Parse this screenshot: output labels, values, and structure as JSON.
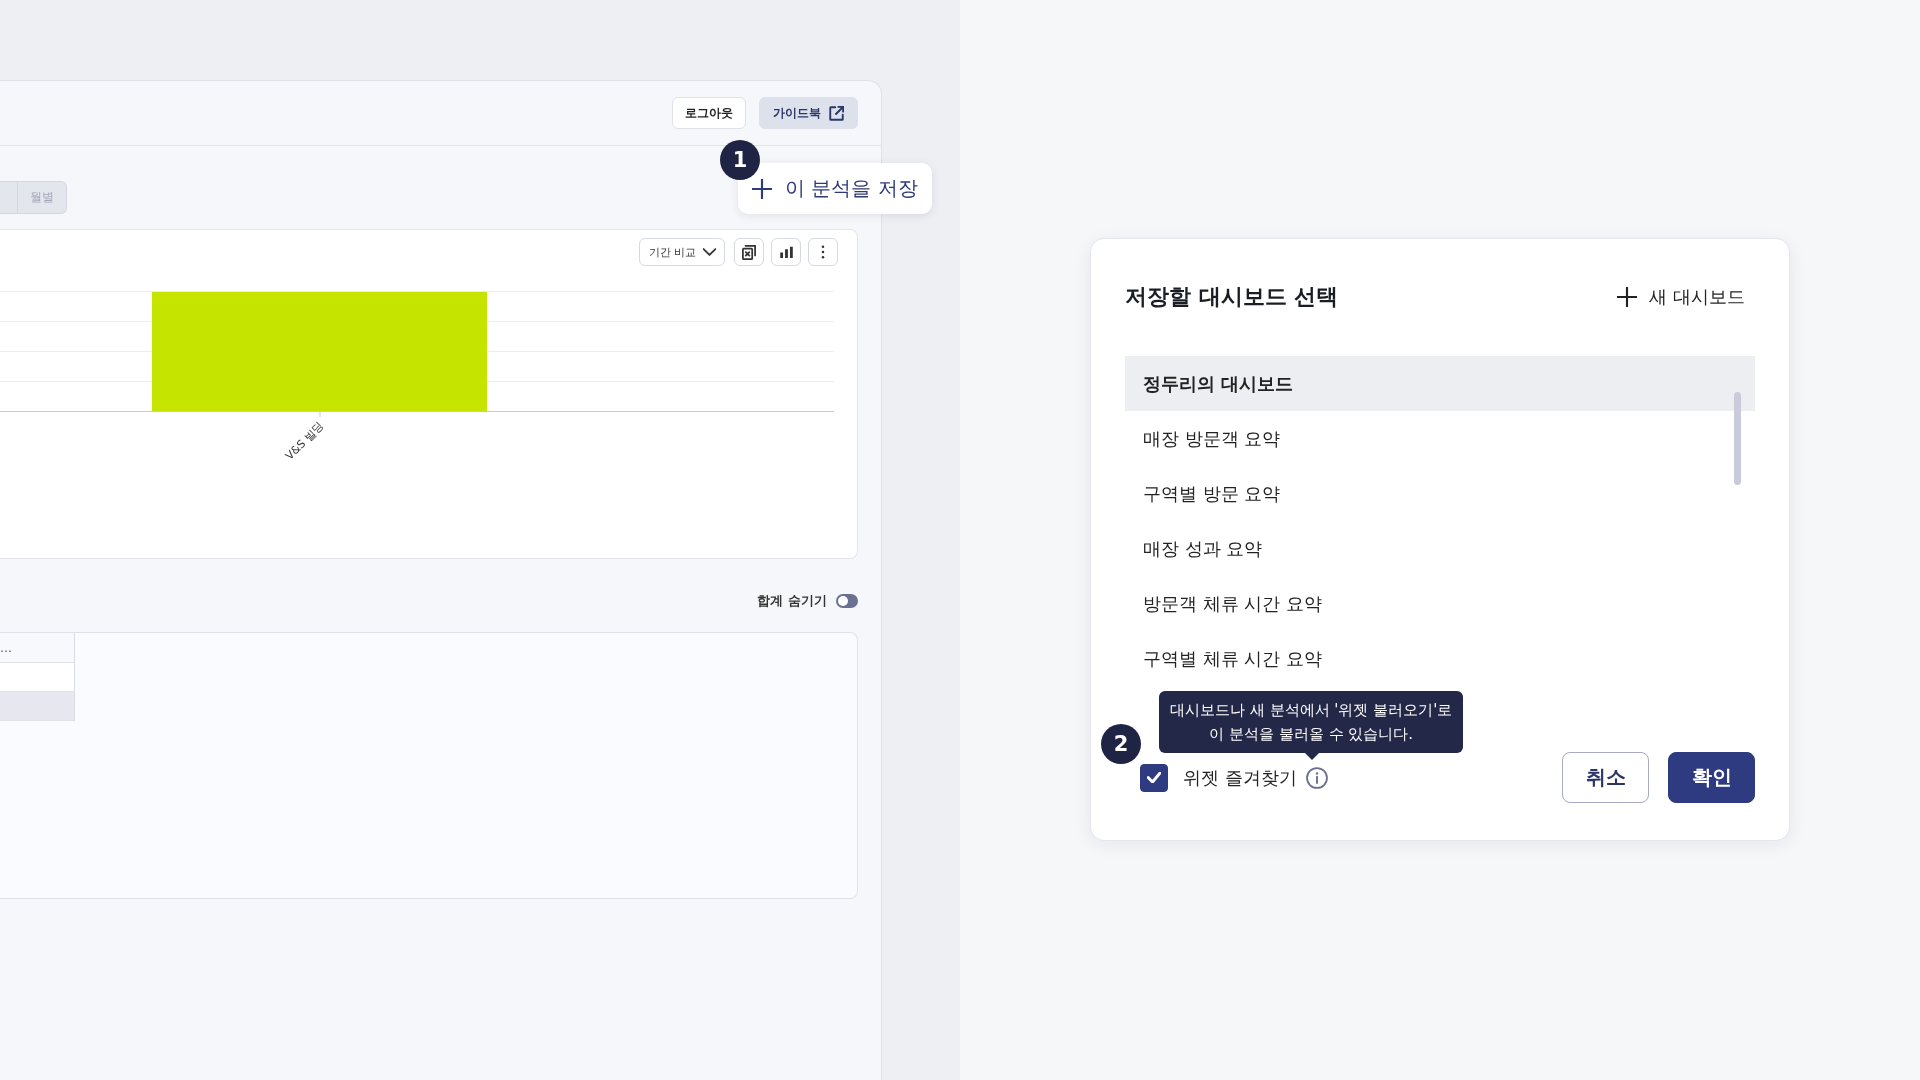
{
  "app_panel": {
    "header_buttons": [
      {
        "kind": "plain",
        "label": "로그아웃"
      },
      {
        "kind": "external",
        "label": "가이드북"
      }
    ],
    "period_tabs": [
      {
        "label": "월별",
        "selected": false
      }
    ],
    "chart_card": {
      "compare_dropdown": "기간 비교",
      "chart": {
        "category_labels": [
          "V&S 빌딩"
        ]
      }
    },
    "total_toggle": {
      "label": "합계 숨기기",
      "on": false
    },
    "table": {
      "columns": [
        "…"
      ]
    }
  },
  "save_callout": {
    "step": "1",
    "label": "이 분석을 저장"
  },
  "dialog": {
    "title": "저장할 대시보드 선택",
    "new_button": "새 대시보드",
    "dashboards": [
      {
        "label": "정두리의 대시보드",
        "selected": true
      },
      {
        "label": "매장 방문객 요약",
        "selected": false
      },
      {
        "label": "구역별 방문 요약",
        "selected": false
      },
      {
        "label": "매장 성과 요약",
        "selected": false
      },
      {
        "label": "방문객 체류 시간 요약",
        "selected": false
      },
      {
        "label": "구역별 체류 시간 요약",
        "selected": false
      }
    ],
    "favorite": {
      "step": "2",
      "label": "위젯 즐겨찾기",
      "checked": true,
      "tooltip_lines": [
        "대시보드나 새 분석에서 '위젯 불러오기'로",
        "이 분석을 불러올 수 있습니다."
      ]
    },
    "buttons": [
      {
        "kind": "secondary",
        "label": "취소"
      },
      {
        "kind": "primary",
        "label": "확인"
      }
    ]
  }
}
